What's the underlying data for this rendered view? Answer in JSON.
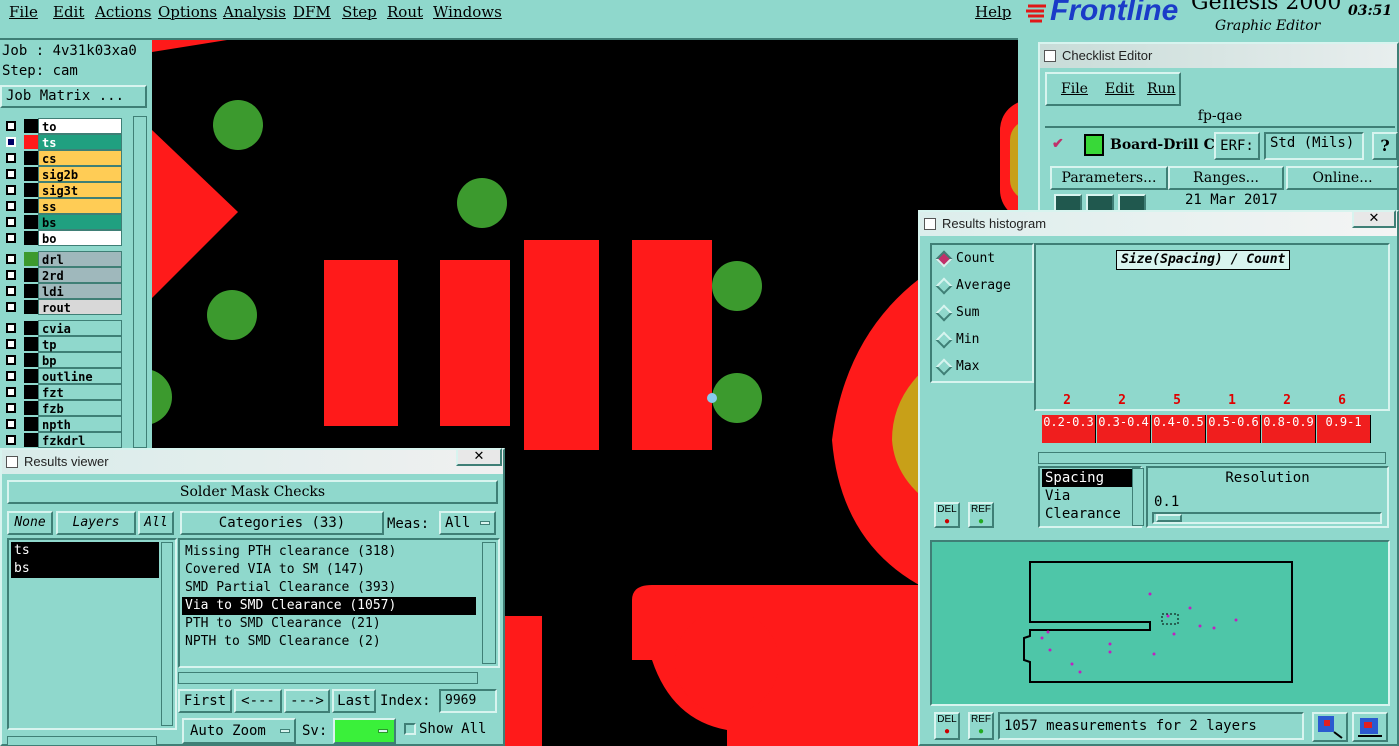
{
  "menubar": {
    "file": "File",
    "edit": "Edit",
    "actions": "Actions",
    "options": "Options",
    "analysis": "Analysis",
    "dfm": "DFM",
    "step": "Step",
    "rout": "Rout",
    "windows": "Windows",
    "help": "Help"
  },
  "brand": {
    "logo": "Frontline",
    "product": "Genesis 2000",
    "subtitle": "Graphic Editor",
    "time": "03:51"
  },
  "job": {
    "job_label": "Job : 4v31k03xa0",
    "step_label": "Step: cam",
    "matrix_button": "Job Matrix ..."
  },
  "layers": [
    {
      "name": "to",
      "color": "#ffffff",
      "swatch": "#000000",
      "selected": false
    },
    {
      "name": "ts",
      "color": "#20a080",
      "swatch": "#ff1a1a",
      "selected": true
    },
    {
      "name": "cs",
      "color": "#ffcc55",
      "swatch": "#000000",
      "selected": false
    },
    {
      "name": "sig2b",
      "color": "#ffcc55",
      "swatch": "#000000",
      "selected": false
    },
    {
      "name": "sig3t",
      "color": "#ffcc55",
      "swatch": "#000000",
      "selected": false
    },
    {
      "name": "ss",
      "color": "#ffcc55",
      "swatch": "#000000",
      "selected": false
    },
    {
      "name": "bs",
      "color": "#20a080",
      "swatch": "#000000",
      "selected": false
    },
    {
      "name": "bo",
      "color": "#ffffff",
      "swatch": "#000000",
      "selected": false
    },
    {
      "name": "drl",
      "color": "#9fb8bc",
      "swatch": "#3c9a2e",
      "selected": false
    },
    {
      "name": "2rd",
      "color": "#9fb8bc",
      "swatch": "#000000",
      "selected": false
    },
    {
      "name": "ldi",
      "color": "#9fb8bc",
      "swatch": "#000000",
      "selected": false
    },
    {
      "name": "rout",
      "color": "#d8d8d8",
      "swatch": "#000000",
      "selected": false
    },
    {
      "name": "cvia",
      "color": "#8fd8cc",
      "swatch": "#000000",
      "selected": false
    },
    {
      "name": "tp",
      "color": "#8fd8cc",
      "swatch": "#000000",
      "selected": false
    },
    {
      "name": "bp",
      "color": "#8fd8cc",
      "swatch": "#000000",
      "selected": false
    },
    {
      "name": "outline",
      "color": "#8fd8cc",
      "swatch": "#000000",
      "selected": false
    },
    {
      "name": "fzt",
      "color": "#8fd8cc",
      "swatch": "#000000",
      "selected": false
    },
    {
      "name": "fzb",
      "color": "#8fd8cc",
      "swatch": "#000000",
      "selected": false
    },
    {
      "name": "npth",
      "color": "#8fd8cc",
      "swatch": "#000000",
      "selected": false
    },
    {
      "name": "fzkdrl",
      "color": "#8fd8cc",
      "swatch": "#000000",
      "selected": false
    }
  ],
  "results_viewer": {
    "title": "Results viewer",
    "header": "Solder Mask Checks",
    "none_button": "None",
    "layers_button": "Layers",
    "all_button": "All",
    "layers_list": [
      "ts",
      "bs"
    ],
    "categories_button": "Categories (33)",
    "meas_label": "Meas:",
    "meas_value": "All",
    "categories": [
      {
        "label": "Missing PTH clearance (318)",
        "selected": false
      },
      {
        "label": "Covered VIA to SM (147)",
        "selected": false
      },
      {
        "label": "SMD Partial Clearance (393)",
        "selected": false
      },
      {
        "label": "Via to SMD Clearance (1057)",
        "selected": true
      },
      {
        "label": "PTH to SMD Clearance (21)",
        "selected": false
      },
      {
        "label": "NPTH to SMD Clearance (2)",
        "selected": false
      }
    ],
    "first_button": "First",
    "prev_button": "<---",
    "next_button": "--->",
    "last_button": "Last",
    "index_label": "Index:",
    "index_value": "9969",
    "auto_zoom": "Auto Zoom",
    "sv_label": "Sv:",
    "show_all": "Show All"
  },
  "checklist_editor": {
    "title": "Checklist Editor",
    "menu": {
      "file": "File",
      "edit": "Edit",
      "run": "Run"
    },
    "name": "fp-qae",
    "check_name": "Board-Drill Che",
    "erf_label": "ERF:",
    "erf_value": "Std (Mils)",
    "help": "?",
    "parameters_button": "Parameters...",
    "ranges_button": "Ranges...",
    "online_button": "Online...",
    "date": "21 Mar 2017"
  },
  "histogram": {
    "title": "Results histogram",
    "modes": [
      {
        "label": "Count",
        "selected": true
      },
      {
        "label": "Average",
        "selected": false
      },
      {
        "label": "Sum",
        "selected": false
      },
      {
        "label": "Min",
        "selected": false
      },
      {
        "label": "Max",
        "selected": false
      }
    ],
    "chart_title": "Size(Spacing) / Count",
    "bins": [
      {
        "count": "2",
        "range": "0.2-0.3"
      },
      {
        "count": "2",
        "range": "0.3-0.4"
      },
      {
        "count": "5",
        "range": "0.4-0.5"
      },
      {
        "count": "1",
        "range": "0.5-0.6"
      },
      {
        "count": "2",
        "range": "0.8-0.9"
      },
      {
        "count": "6",
        "range": "0.9-1"
      }
    ],
    "measure_types": [
      {
        "label": "Spacing",
        "selected": true
      },
      {
        "label": "Via",
        "selected": false
      },
      {
        "label": "Clearance",
        "selected": false
      }
    ],
    "resolution_label": "Resolution",
    "resolution_value": "0.1",
    "del_label": "DEL",
    "ref_label": "REF",
    "status": "1057 measurements for 2 layers"
  }
}
